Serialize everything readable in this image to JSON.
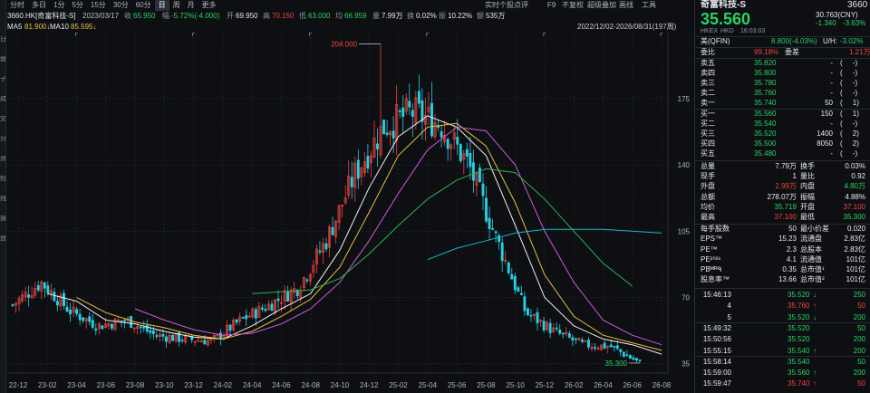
{
  "toolbar": {
    "periods": [
      "分时",
      "多日",
      "1分",
      "5分",
      "15分",
      "30分",
      "60分",
      "日",
      "周",
      "月",
      "更多"
    ],
    "active_period": "日",
    "right_items": [
      "实时个股点评",
      "F9",
      "不复权",
      "超级叠加",
      "画线",
      "工具"
    ]
  },
  "left_strip": [
    "日",
    "盘",
    "子",
    "成",
    "交",
    "分",
    "资",
    "短",
    "线",
    "操",
    "盘"
  ],
  "info": {
    "code": "3660.HK[奇富科技-S]",
    "date": "2023/03/17",
    "close_k": "收",
    "close_v": "65.950",
    "chg_k": "幅",
    "chg_v": "-5.72%(-4.000)",
    "open_k": "开",
    "open_v": "69.950",
    "high_k": "高",
    "high_v": "70.150",
    "low_k": "低",
    "low_v": "63.000",
    "avg_k": "均",
    "avg_v": "66.959",
    "amt_k": "量",
    "amt_v": "7.99万",
    "turn_k": "换",
    "turn_v": "0.02%",
    "amp_k": "振",
    "amp_v": "10.22%",
    "vol_k": "额",
    "vol_v": "535万"
  },
  "ma": {
    "ma5_label": "MA5",
    "ma5_value": "81.900↓",
    "ma10_label": "MA10",
    "ma10_value": "85.595↓"
  },
  "range_label": "2022/12/02-2026/08/31(197周)",
  "price_axis": [
    "175",
    "140",
    "105",
    "70",
    "35"
  ],
  "time_axis": [
    "22-12",
    "23-02",
    "23-04",
    "23-06",
    "23-08",
    "23-10",
    "23-12",
    "24-02",
    "24-04",
    "24-06",
    "24-08",
    "24-10",
    "24-12",
    "25-02",
    "25-04",
    "25-06",
    "25-08",
    "25-10",
    "25-12",
    "26-02",
    "26-04",
    "26-06",
    "26-08"
  ],
  "annotations": {
    "high_label": "204.000",
    "low_label": "35.300"
  },
  "colors": {
    "up": "#f0443c",
    "down": "#25d0e0",
    "ma5": "#f2f2f2",
    "ma10": "#e8c03a",
    "ma20": "#d25ad6",
    "ma60": "#2fb34f",
    "ma120": "#23b3c8",
    "bg": "#0d0f13",
    "grid": "#1e2229"
  },
  "chart_data": {
    "type": "candlestick",
    "x": [
      "22-12",
      "23-02",
      "23-04",
      "23-06",
      "23-08",
      "23-10",
      "23-12",
      "24-02",
      "24-04",
      "24-06",
      "24-08",
      "24-10",
      "24-12",
      "25-02",
      "25-04",
      "25-06",
      "25-08",
      "25-10",
      "25-12",
      "26-02",
      "26-04",
      "26-06",
      "26-08"
    ],
    "close": [
      66,
      78,
      63,
      55,
      58,
      50,
      48,
      47,
      58,
      66,
      75,
      100,
      135,
      160,
      168,
      162,
      140,
      100,
      62,
      52,
      45,
      44,
      35.3
    ],
    "high_mark": 204.0,
    "low_mark": 35.3,
    "ylim": [
      30,
      210
    ],
    "series": [
      {
        "name": "MA5",
        "values": [
          null,
          72,
          68,
          58,
          56,
          52,
          49,
          48,
          55,
          64,
          72,
          95,
          128,
          155,
          166,
          160,
          145,
          108,
          70,
          55,
          48,
          45,
          40
        ]
      },
      {
        "name": "MA10",
        "values": [
          null,
          null,
          70,
          62,
          57,
          54,
          50,
          48,
          52,
          60,
          69,
          86,
          115,
          145,
          160,
          162,
          150,
          120,
          82,
          60,
          50,
          46,
          42
        ]
      },
      {
        "name": "MA20",
        "values": [
          null,
          null,
          null,
          null,
          64,
          58,
          53,
          50,
          51,
          56,
          64,
          78,
          100,
          125,
          148,
          160,
          158,
          140,
          105,
          78,
          58,
          50,
          45
        ]
      },
      {
        "name": "MA60",
        "values": [
          null,
          null,
          null,
          null,
          null,
          null,
          null,
          null,
          72,
          73,
          74,
          80,
          93,
          108,
          122,
          132,
          138,
          136,
          122,
          105,
          88,
          76,
          null
        ]
      },
      {
        "name": "MA120",
        "values": [
          null,
          null,
          null,
          null,
          null,
          null,
          null,
          null,
          null,
          null,
          null,
          null,
          null,
          null,
          90,
          96,
          100,
          104,
          106,
          106,
          106,
          105,
          104
        ]
      }
    ]
  },
  "panel": {
    "title": "奇富科技-S",
    "code": "3660",
    "price": "35.560",
    "ref_price": "30.763(CNY)",
    "change": "-1.340",
    "change_pct": "-3.63%",
    "market": "HKEX",
    "currency": "HKD",
    "time": "16:03:03",
    "us_label": "美(QFIN)",
    "us_value": "8.800(-4.03%)",
    "us_ratio_label": "U/H:",
    "us_ratio": "-3.02%",
    "wb_label": "委比",
    "wb_value": "99.18%",
    "wc_label": "委差",
    "wc_value": "1.21万",
    "asks": [
      {
        "label": "卖五",
        "price": "35.820",
        "vol": "-",
        "cnt": "(     -)"
      },
      {
        "label": "卖四",
        "price": "35.800",
        "vol": "-",
        "cnt": "(     -)"
      },
      {
        "label": "卖三",
        "price": "35.780",
        "vol": "-",
        "cnt": "(     -)"
      },
      {
        "label": "卖二",
        "price": "35.760",
        "vol": "-",
        "cnt": "(     -)"
      },
      {
        "label": "卖一",
        "price": "35.740",
        "vol": "50",
        "cnt": "(     1)"
      }
    ],
    "bids": [
      {
        "label": "买一",
        "price": "35.560",
        "vol": "150",
        "cnt": "(     1)"
      },
      {
        "label": "买二",
        "price": "35.540",
        "vol": "-",
        "cnt": "(     -)"
      },
      {
        "label": "买三",
        "price": "35.520",
        "vol": "1400",
        "cnt": "(     2)"
      },
      {
        "label": "买四",
        "price": "35.500",
        "vol": "8050",
        "cnt": "(     2)"
      },
      {
        "label": "买五",
        "price": "35.480",
        "vol": "-",
        "cnt": "(     -)"
      }
    ],
    "stats": [
      {
        "k1": "总量",
        "v1": "7.79万",
        "c1": "white",
        "k2": "换手",
        "v2": "0.03%",
        "c2": "white"
      },
      {
        "k1": "现手",
        "v1": "1",
        "c1": "white",
        "k2": "量比",
        "v2": "0.92",
        "c2": "white"
      },
      {
        "k1": "外盘",
        "v1": "2.99万",
        "c1": "red",
        "k2": "内盘",
        "v2": "4.80万",
        "c2": "green"
      },
      {
        "k1": "总额",
        "v1": "278.07万",
        "c1": "white",
        "k2": "振幅",
        "v2": "4.88%",
        "c2": "white"
      },
      {
        "k1": "均价",
        "v1": "35.719",
        "c1": "green",
        "k2": "开盘",
        "v2": "37.100",
        "c2": "red"
      },
      {
        "k1": "最高",
        "v1": "37.100",
        "c1": "red",
        "k2": "最低",
        "v2": "35.300",
        "c2": "green"
      },
      {
        "k1": "每手股数",
        "v1": "50",
        "c1": "white",
        "k2": "最小价差",
        "v2": "0.020",
        "c2": "white"
      },
      {
        "k1": "EPS™",
        "v1": "15.23",
        "c1": "white",
        "k2": "流通盘",
        "v2": "2.83亿",
        "c2": "white"
      },
      {
        "k1": "PE™",
        "v1": "2.3",
        "c1": "white",
        "k2": "总股本",
        "v2": "2.83亿",
        "c2": "white"
      },
      {
        "k1": "PE²⁰²⁶",
        "v1": "4.1",
        "c1": "white",
        "k2": "流通值",
        "v2": "101亿",
        "c2": "white"
      },
      {
        "k1": "PBᴹᴿᑫ",
        "v1": "0.35",
        "c1": "white",
        "k2": "总市值¹",
        "v2": "101亿",
        "c2": "white"
      },
      {
        "k1": "股息率™",
        "v1": "13.66",
        "c1": "white",
        "k2": "总市值²",
        "v2": "101亿",
        "c2": "white"
      }
    ],
    "ticks": [
      {
        "time": "15:46:13",
        "price": "35.520",
        "dir": "↓",
        "vol": "250",
        "c": "green",
        "vc": "green"
      },
      {
        "time": "4",
        "price": "35.760",
        "dir": "↑",
        "vol": "50",
        "c": "red",
        "vc": "red"
      },
      {
        "time": "5",
        "price": "35.520",
        "dir": "↓",
        "vol": "200",
        "c": "green",
        "vc": "green"
      },
      {
        "time": "15:49:32",
        "price": "35.520",
        "dir": "",
        "vol": "50",
        "c": "green",
        "vc": "green"
      },
      {
        "time": "15:50:56",
        "price": "35.520",
        "dir": "",
        "vol": "200",
        "c": "green",
        "vc": "green"
      },
      {
        "time": "15:55:15",
        "price": "35.540",
        "dir": "↑",
        "vol": "200",
        "c": "green",
        "vc": "green"
      },
      {
        "time": "15:58:14",
        "price": "35.540",
        "dir": "",
        "vol": "50",
        "c": "green",
        "vc": "green"
      },
      {
        "time": "15:59:00",
        "price": "35.560",
        "dir": "↑",
        "vol": "200",
        "c": "green",
        "vc": "green"
      },
      {
        "time": "15:59:47",
        "price": "35.740",
        "dir": "↑",
        "vol": "50",
        "c": "red",
        "vc": "red"
      }
    ]
  }
}
